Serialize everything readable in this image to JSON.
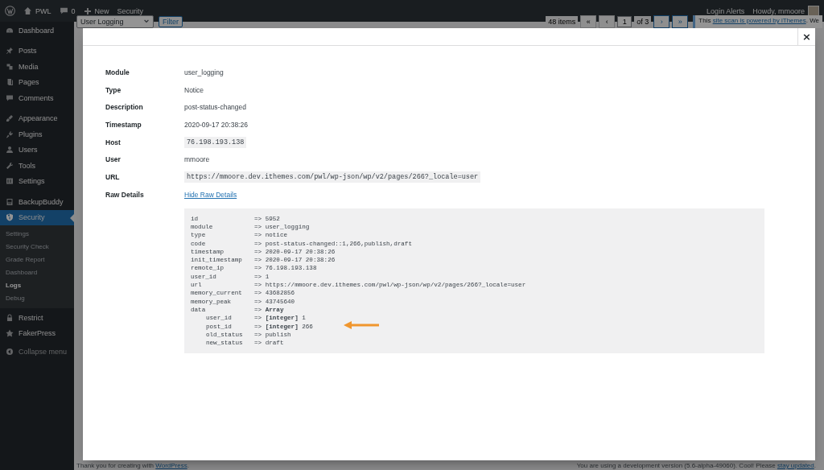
{
  "admin_bar": {
    "site_name": "PWL",
    "comments_count": "0",
    "new_label": "New",
    "left_items": [
      "Security"
    ],
    "right_items": [
      "Login Alerts",
      "Howdy, mmoore"
    ]
  },
  "sidebar": {
    "sections": [
      {
        "items": [
          {
            "label": "Dashboard",
            "selected": false
          }
        ]
      },
      {
        "items": [
          {
            "label": "Posts",
            "selected": false
          },
          {
            "label": "Media",
            "selected": false
          },
          {
            "label": "Pages",
            "selected": false
          },
          {
            "label": "Comments",
            "selected": false
          }
        ]
      },
      {
        "items": [
          {
            "label": "Appearance",
            "selected": false
          },
          {
            "label": "Plugins",
            "selected": false
          },
          {
            "label": "Users",
            "selected": false
          },
          {
            "label": "Tools",
            "selected": false
          },
          {
            "label": "Settings",
            "selected": false
          }
        ]
      },
      {
        "items": [
          {
            "label": "BackupBuddy",
            "selected": false
          },
          {
            "label": "Security",
            "selected": true,
            "children": [
              {
                "label": "Settings",
                "selected": false
              },
              {
                "label": "Security Check",
                "selected": false
              },
              {
                "label": "Grade Report",
                "selected": false
              },
              {
                "label": "Dashboard",
                "selected": false
              },
              {
                "label": "Logs",
                "selected": true
              },
              {
                "label": "Debug",
                "selected": false
              }
            ]
          },
          {
            "label": "Restrict",
            "selected": false
          },
          {
            "label": "FakerPress",
            "selected": false
          }
        ]
      }
    ],
    "collapse_label": "Collapse menu"
  },
  "toolbar": {
    "filter_select": "User Logging",
    "filter_button": "Filter",
    "items_count": "48 items",
    "pagination": {
      "first": "«",
      "previous": "‹",
      "current_page": "1",
      "of_pages": "of 3",
      "next": "›",
      "last": "»"
    },
    "notice": "This **site scan is powered by iThemes**. We"
  },
  "modal": {
    "close": "×",
    "fields": [
      {
        "label": "Module",
        "value": "user_logging",
        "kind": "text"
      },
      {
        "label": "Type",
        "value": "Notice",
        "kind": "text"
      },
      {
        "label": "Description",
        "value": "post-status-changed",
        "kind": "text"
      },
      {
        "label": "Timestamp",
        "value": "2020-09-17 20:38:26",
        "kind": "text"
      },
      {
        "label": "Host",
        "value": "76.198.193.138",
        "kind": "code"
      },
      {
        "label": "User",
        "value": "mmoore",
        "kind": "text"
      },
      {
        "label": "URL",
        "value": "https://mmoore.dev.ithemes.com/pwl/wp-json/wp/v2/pages/266?_locale=user",
        "kind": "code"
      },
      {
        "label": "Raw Details",
        "value": "Hide Raw Details",
        "kind": "link"
      }
    ],
    "raw_details": [
      {
        "key": "id",
        "value": "=> 5952"
      },
      {
        "key": "module",
        "value": "=> user_logging"
      },
      {
        "key": "type",
        "value": "=> notice"
      },
      {
        "key": "code",
        "value": "=> post-status-changed::1,266,publish,draft"
      },
      {
        "key": "timestamp",
        "value": "=> 2020-09-17 20:38:26"
      },
      {
        "key": "init_timestamp",
        "value": "=> 2020-09-17 20:38:26"
      },
      {
        "key": "remote_ip",
        "value": "=> 76.198.193.138"
      },
      {
        "key": "user_id",
        "value": "=> 1"
      },
      {
        "key": "url",
        "value": "=> https://mmoore.dev.ithemes.com/pwl/wp-json/wp/v2/pages/266?_locale=user"
      },
      {
        "key": "memory_current",
        "value": "=> 43682856"
      },
      {
        "key": "memory_peak",
        "value": "=> 43745640"
      },
      {
        "key": "data",
        "value": "=> **Array**",
        "children": [
          {
            "key": "user_id",
            "value": "=> **[integer]** 1",
            "highlighted": false
          },
          {
            "key": "post_id",
            "value": "=> **[integer]** 266",
            "highlighted": true
          },
          {
            "key": "old_status",
            "value": "=> publish",
            "highlighted": false
          },
          {
            "key": "new_status",
            "value": "=> draft",
            "highlighted": false
          }
        ]
      }
    ]
  },
  "footer": {
    "left": "Thank you for creating with **WordPress**.",
    "right": "You are using a development version (5.6-alpha-49060). Cool! Please **stay updated**."
  }
}
